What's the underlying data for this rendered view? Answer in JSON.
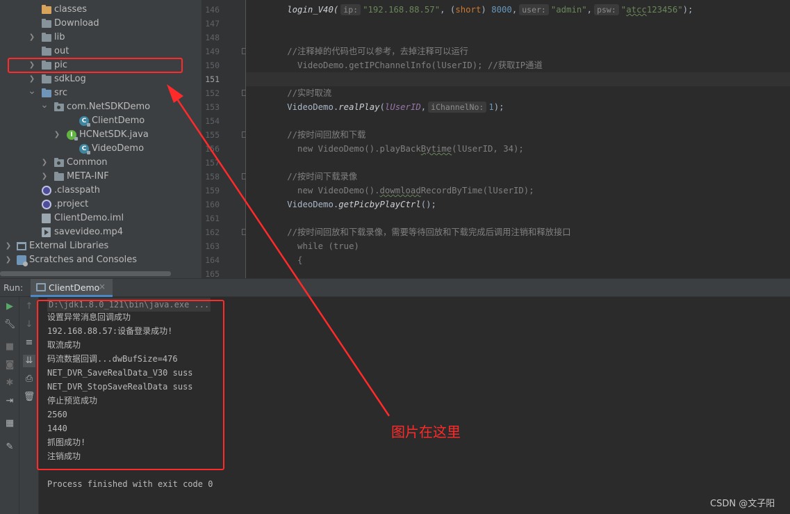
{
  "project_tree": {
    "items": [
      {
        "label": "classes",
        "icon": "folder-orange-icon",
        "indent": 1,
        "arrow": ""
      },
      {
        "label": "Download",
        "icon": "folder-icon",
        "indent": 1,
        "arrow": ""
      },
      {
        "label": "lib",
        "icon": "folder-icon",
        "indent": 1,
        "arrow": ">"
      },
      {
        "label": "out",
        "icon": "folder-icon",
        "indent": 1,
        "arrow": ""
      },
      {
        "label": "pic",
        "icon": "folder-icon",
        "indent": 1,
        "arrow": ">",
        "selected": true
      },
      {
        "label": "sdkLog",
        "icon": "folder-icon",
        "indent": 1,
        "arrow": ">"
      },
      {
        "label": "src",
        "icon": "folder-blue-icon",
        "indent": 1,
        "arrow": "v"
      },
      {
        "label": "com.NetSDKDemo",
        "icon": "package-icon",
        "indent": 2,
        "arrow": "v"
      },
      {
        "label": "ClientDemo",
        "icon": "java-class-icon",
        "indent": 4,
        "arrow": ""
      },
      {
        "label": "HCNetSDK.java",
        "icon": "java-interface-icon",
        "indent": 3,
        "arrow": ">"
      },
      {
        "label": "VideoDemo",
        "icon": "java-class-icon",
        "indent": 4,
        "arrow": ""
      },
      {
        "label": "Common",
        "icon": "package-icon",
        "indent": 2,
        "arrow": ">"
      },
      {
        "label": "META-INF",
        "icon": "folder-icon",
        "indent": 2,
        "arrow": ">"
      },
      {
        "label": ".classpath",
        "icon": "eclipse-file-icon",
        "indent": 1,
        "arrow": ""
      },
      {
        "label": ".project",
        "icon": "eclipse-file-icon",
        "indent": 1,
        "arrow": ""
      },
      {
        "label": "ClientDemo.iml",
        "icon": "iml-file-icon",
        "indent": 1,
        "arrow": ""
      },
      {
        "label": "savevideo.mp4",
        "icon": "video-file-icon",
        "indent": 1,
        "arrow": ""
      },
      {
        "label": "External Libraries",
        "icon": "library-icon",
        "indent": 0,
        "arrow": ">"
      },
      {
        "label": "Scratches and Consoles",
        "icon": "scratch-icon",
        "indent": 0,
        "arrow": ">"
      }
    ]
  },
  "editor": {
    "current_line": "151",
    "lines": [
      {
        "num": "146",
        "gutter": "",
        "fold": false
      },
      {
        "num": "147",
        "gutter": "",
        "fold": false
      },
      {
        "num": "148",
        "gutter": "",
        "fold": false
      },
      {
        "num": "149",
        "gutter": "",
        "fold": true
      },
      {
        "num": "150",
        "gutter": "//",
        "fold": false
      },
      {
        "num": "151",
        "gutter": "",
        "fold": false
      },
      {
        "num": "152",
        "gutter": "",
        "fold": true
      },
      {
        "num": "153",
        "gutter": "",
        "fold": false
      },
      {
        "num": "154",
        "gutter": "",
        "fold": false
      },
      {
        "num": "155",
        "gutter": "",
        "fold": true
      },
      {
        "num": "156",
        "gutter": "//",
        "fold": false
      },
      {
        "num": "157",
        "gutter": "",
        "fold": false
      },
      {
        "num": "158",
        "gutter": "",
        "fold": true
      },
      {
        "num": "159",
        "gutter": "//",
        "fold": false
      },
      {
        "num": "160",
        "gutter": "",
        "fold": false
      },
      {
        "num": "161",
        "gutter": "",
        "fold": false
      },
      {
        "num": "162",
        "gutter": "",
        "fold": true
      },
      {
        "num": "163",
        "gutter": "//",
        "fold": false
      },
      {
        "num": "164",
        "gutter": "//",
        "fold": false
      },
      {
        "num": "165",
        "gutter": "//",
        "fold": false
      }
    ],
    "code": {
      "l146_method": "login_V40(",
      "l146_hint_ip": "ip:",
      "l146_ip": "\"192.168.88.57\"",
      "l146_sep1": ", (",
      "l146_short": "short",
      "l146_sep2": ") ",
      "l146_port": "8000",
      "l146_sep3": ",",
      "l146_hint_user": "user:",
      "l146_user": "\"admin\"",
      "l146_sep4": ",",
      "l146_hint_psw": "psw:",
      "l146_psw_q1": "\"",
      "l146_psw": "atcc",
      "l146_psw_rest": "123456\"",
      "l146_end": ");",
      "l149": "//注释掉的代码也可以参考，去掉注释可以运行",
      "l150": "  VideoDemo.getIPChannelInfo(lUserID); //获取IP通道",
      "l152": "//实时取流",
      "l153_cls": "VideoDemo.",
      "l153_method": "realPlay",
      "l153_open": "(",
      "l153_arg": "lUserID",
      "l153_comma": ",",
      "l153_hint": "iChannelNo:",
      "l153_num": "1",
      "l153_end": ");",
      "l155": "//按时间回放和下载",
      "l156_a": "  new VideoDemo().playBack",
      "l156_b": "Bytime",
      "l156_c": "(lUserID, 34);",
      "l158": "//按时间下载录像",
      "l159_a": "  new VideoDemo().",
      "l159_b": "dowmload",
      "l159_c": "RecordByTime(lUserID);",
      "l160_cls": "VideoDemo.",
      "l160_method": "getPicbyPlayCtrl",
      "l160_end": "();",
      "l162": "//按时间回放和下载录像，需要等待回放和下载完成后调用注销和释放接口",
      "l163": "  while (true)",
      "l164": "  {"
    }
  },
  "run": {
    "label": "Run:",
    "tab_label": "ClientDemo",
    "tab_close": "×",
    "command": "D:\\jdk1.8.0_121\\bin\\java.exe ...",
    "output": [
      "设置异常消息回调成功",
      "192.168.88.57:设备登录成功!",
      "取流成功",
      "码流数据回调...dwBufSize=476",
      "NET_DVR_SaveRealData_V30 suss",
      "NET_DVR_StopSaveRealData suss",
      "停止预览成功",
      "2560",
      "1440",
      "抓图成功!",
      "注销成功"
    ],
    "exit_message": "Process finished with exit code 0"
  },
  "annotation": {
    "note": "图片在这里",
    "color": "#ff2a2a"
  },
  "watermark": "CSDN @文子阳"
}
